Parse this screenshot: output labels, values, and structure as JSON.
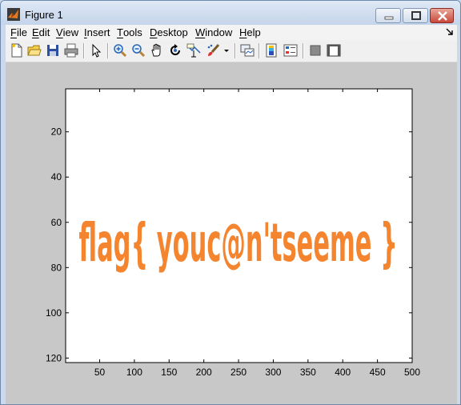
{
  "window": {
    "title": "Figure 1"
  },
  "menu": {
    "items": [
      {
        "label": "File",
        "key": "F",
        "rest": "ile"
      },
      {
        "label": "Edit",
        "key": "E",
        "rest": "dit"
      },
      {
        "label": "View",
        "key": "V",
        "rest": "iew"
      },
      {
        "label": "Insert",
        "key": "I",
        "rest": "nsert"
      },
      {
        "label": "Tools",
        "key": "T",
        "rest": "ools"
      },
      {
        "label": "Desktop",
        "key": "D",
        "rest": "esktop"
      },
      {
        "label": "Window",
        "key": "W",
        "rest": "indow"
      },
      {
        "label": "Help",
        "key": "H",
        "rest": "elp"
      }
    ]
  },
  "toolbar": {
    "icons": [
      "new-figure-icon",
      "open-file-icon",
      "save-icon",
      "print-icon",
      "edit-plot-arrow-icon",
      "zoom-in-icon",
      "zoom-out-icon",
      "pan-hand-icon",
      "rotate-3d-icon",
      "data-cursor-icon",
      "brush-icon",
      "brush-dropdown-icon",
      "link-plot-icon",
      "colorbar-icon",
      "legend-icon",
      "hide-plot-tools-icon",
      "show-plot-tools-icon"
    ]
  },
  "chart_data": {
    "type": "image",
    "image_text": "flag{ youc@n'tseeme }",
    "image_color": "#f5842f",
    "background": "#ffffff",
    "xlim": [
      1,
      500
    ],
    "ylim": [
      1,
      122
    ],
    "y_reversed": true,
    "xticks": [
      50,
      100,
      150,
      200,
      250,
      300,
      350,
      400,
      450,
      500
    ],
    "yticks": [
      20,
      40,
      60,
      80,
      100,
      120
    ]
  }
}
